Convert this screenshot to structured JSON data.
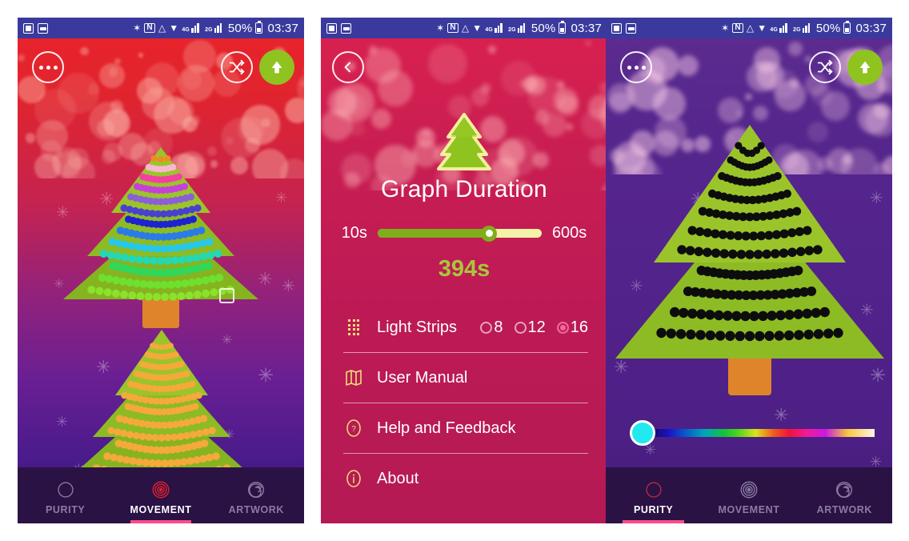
{
  "status_bar": {
    "left_icons": [
      "screenshot-icon",
      "gallery-icon"
    ],
    "right_icons": [
      "bluetooth-icon",
      "nfc-icon",
      "wifi-icon",
      "download-icon",
      "signal-4g-icon",
      "signal-2g-icon"
    ],
    "battery_percent": "50%",
    "time": "03:37",
    "bluetooth_glyph": "✶",
    "nfc_glyph": "N",
    "wifi_glyph": "◠",
    "download_glyph": "⬇",
    "sig1_label": "4G",
    "sig2_label": "2G"
  },
  "panel1": {
    "name": "movement-screen",
    "menu_button": "menu-dots",
    "shuffle_button": "shuffle",
    "upload_button": "upload-arrow",
    "rec_indicator": "stop-square",
    "nav": {
      "items": [
        {
          "label": "PURITY",
          "icon": "circle-icon",
          "active": false
        },
        {
          "label": "MOVEMENT",
          "icon": "concentric-circles-icon",
          "active": true
        },
        {
          "label": "ARTWORK",
          "icon": "spiral-icon",
          "active": false
        }
      ]
    },
    "tree_top_dot_colors": [
      "#f08a24",
      "#f7b8cf",
      "#f53fa1",
      "#c641d6",
      "#8b5fd6",
      "#4a3fd1",
      "#1f22cf",
      "#2a7ae8",
      "#25c8e8",
      "#24d8b4",
      "#2fd85a",
      "#6ee02e",
      "#8ae32a"
    ],
    "tree_bottom_dot_color": "#f5a93a"
  },
  "panel2": {
    "name": "settings-screen",
    "back_button": "back-chevron",
    "logo": "christmas-tree-logo",
    "title": "Graph Duration",
    "slider": {
      "min_label": "10s",
      "max_label": "600s",
      "value_label": "394s",
      "min": 10,
      "max": 600,
      "value": 394,
      "percent": 68
    },
    "rows": [
      {
        "label": "Light Strips",
        "icon": "led-strip-icon",
        "options": [
          {
            "label": "8",
            "selected": false
          },
          {
            "label": "12",
            "selected": false
          },
          {
            "label": "16",
            "selected": true
          }
        ]
      },
      {
        "label": "User Manual",
        "icon": "map-icon",
        "options": []
      },
      {
        "label": "Help and Feedback",
        "icon": "question-circle-icon",
        "options": []
      },
      {
        "label": "About",
        "icon": "info-circle-icon",
        "options": []
      }
    ]
  },
  "panel3": {
    "name": "purity-screen",
    "menu_button": "menu-dots",
    "shuffle_button": "shuffle",
    "upload_button": "upload-arrow",
    "color_slider": {
      "thumb_color": "#22e8f0",
      "position_percent": 0
    },
    "nav": {
      "items": [
        {
          "label": "PURITY",
          "icon": "circle-icon",
          "active": true
        },
        {
          "label": "MOVEMENT",
          "icon": "concentric-circles-icon",
          "active": false
        },
        {
          "label": "ARTWORK",
          "icon": "spiral-icon",
          "active": false
        }
      ]
    },
    "tree_dot_color": "#0d0d0d"
  },
  "colors": {
    "status_bar_bg": "#3a3a9e",
    "accent_green": "#8fc320",
    "accent_pink": "#ff4d88",
    "nav_bg": "#2b1245",
    "settings_bg": "#bd1a55",
    "value_green": "#a7c83b"
  }
}
